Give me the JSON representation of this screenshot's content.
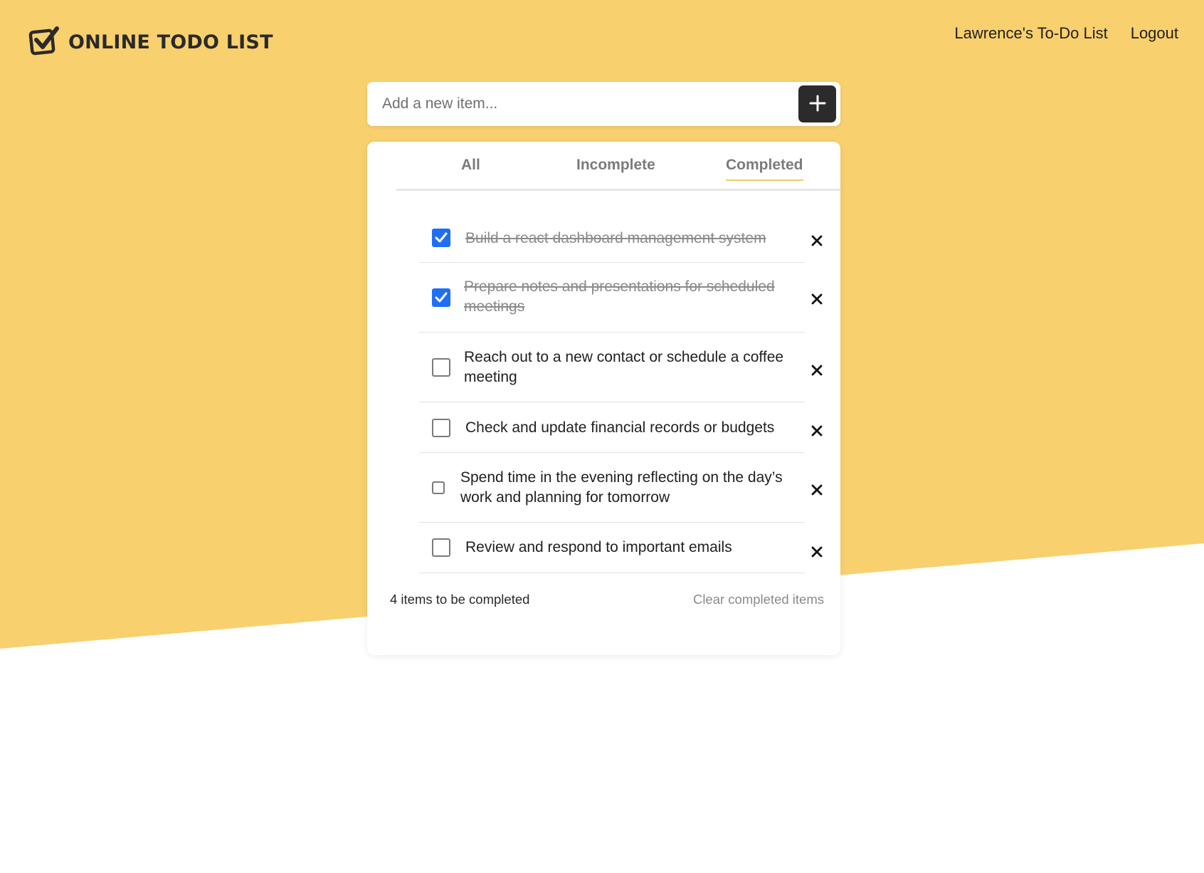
{
  "header": {
    "logo_text": "ONLINE TODO LIST",
    "logo_icon": "checkbox-check-icon",
    "nav": [
      {
        "label": "Lawrence's To-Do List"
      },
      {
        "label": "Logout"
      }
    ]
  },
  "add_item": {
    "placeholder": "Add a new item...",
    "button_icon": "plus-icon"
  },
  "tabs": [
    {
      "label": "All"
    },
    {
      "label": "Incomplete"
    },
    {
      "label": "Completed",
      "active": true
    }
  ],
  "items": [
    {
      "text": "Build a react dashboard management system",
      "completed": true
    },
    {
      "text_line1": "Prepare notes and presentations for scheduled",
      "text_line2": "meetings",
      "completed": true
    },
    {
      "text_line1": "Reach out to a new contact or schedule a coffee",
      "text_line2": "meeting",
      "completed": false
    },
    {
      "text": "Check and update financial records or budgets",
      "completed": false
    },
    {
      "text_line1": "Spend time in the evening reflecting on the day’s",
      "text_line2": "work and planning for tomorrow",
      "completed": false
    },
    {
      "text": "Review and respond to important emails",
      "completed": false
    }
  ],
  "footer": {
    "count_text": "4 items to be completed",
    "clear_label": "Clear completed items"
  },
  "colors": {
    "background_accent": "#f9d06e",
    "checkbox_checked": "#1f6ef5",
    "add_button": "#2b2b2b"
  }
}
